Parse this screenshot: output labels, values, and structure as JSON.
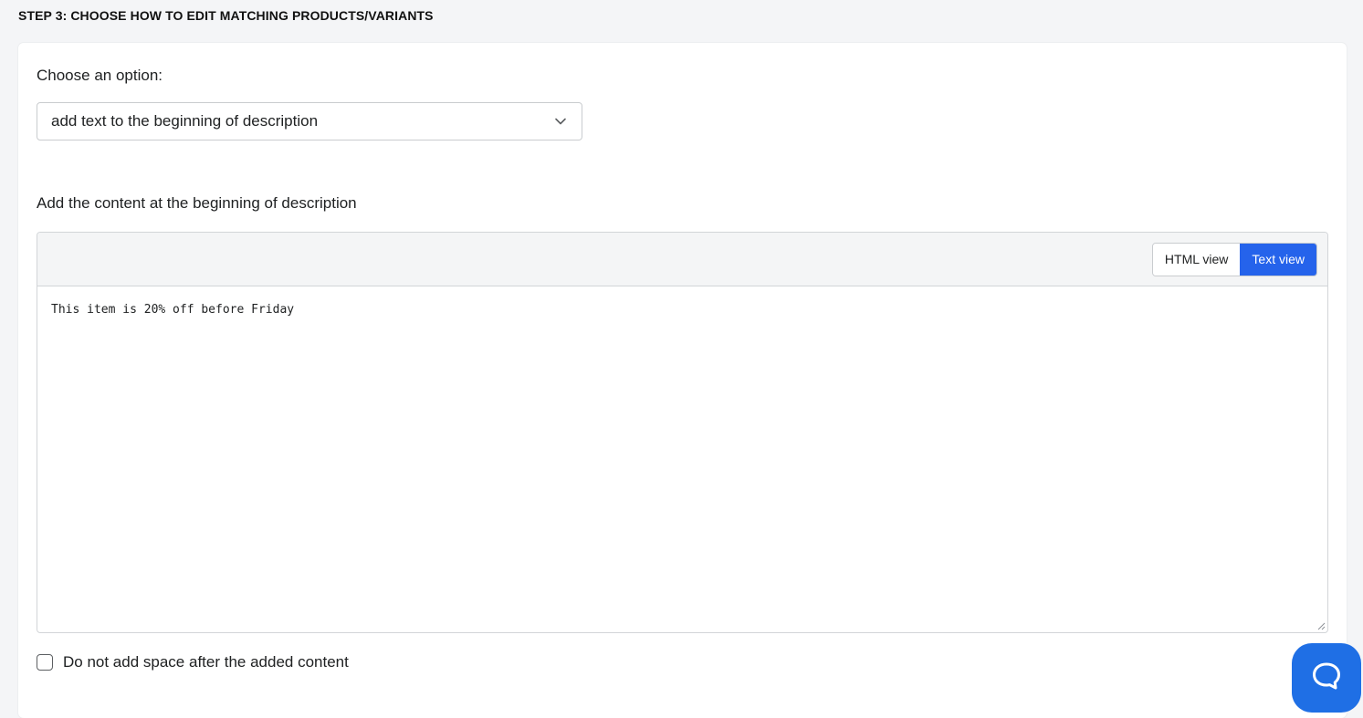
{
  "step": {
    "title": "STEP 3: CHOOSE HOW TO EDIT MATCHING PRODUCTS/VARIANTS"
  },
  "option": {
    "label": "Choose an option:",
    "selected": "add text to the beginning of description",
    "icon": "chevron-down-icon"
  },
  "content": {
    "label": "Add the content at the beginning of description",
    "view_toggle": {
      "html_label": "HTML view",
      "text_label": "Text view",
      "active": "text",
      "active_color": "#2563eb"
    },
    "text": "This item is 20% off before Friday"
  },
  "no_space": {
    "label": "Do not add space after the added content",
    "checked": false
  },
  "chat": {
    "icon": "chat-bubble-icon",
    "color": "#1f6fe5"
  }
}
